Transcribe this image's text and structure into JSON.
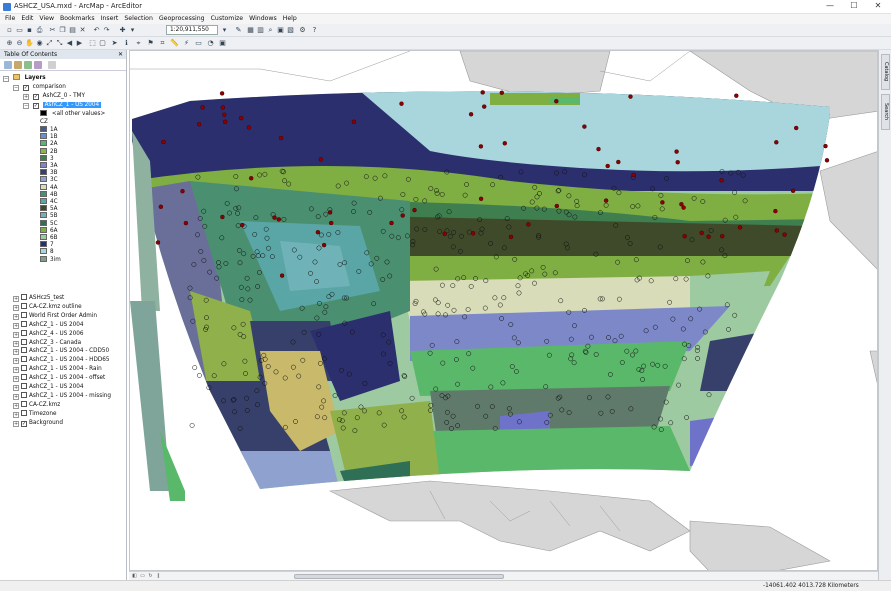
{
  "window": {
    "title": "ASHCZ_USA.mxd - ArcMap - ArcEditor",
    "minimize": "—",
    "maximize": "☐",
    "close": "✕"
  },
  "menu": [
    "File",
    "Edit",
    "View",
    "Bookmarks",
    "Insert",
    "Selection",
    "Geoprocessing",
    "Customize",
    "Windows",
    "Help"
  ],
  "toolbar": {
    "scale": "1:20,911,550"
  },
  "toc": {
    "header": "Table Of Contents",
    "root": "Layers",
    "group": "comparison",
    "layer_tmy": "AshCZ_0 - TMY",
    "layer_selected": "AshCZ_1 - US 2004",
    "legend_other": "<all other values>",
    "legend_field": "CZ",
    "legend": [
      {
        "label": "1A",
        "color": "#4a5a8c"
      },
      {
        "label": "1B",
        "color": "#6f8ec7"
      },
      {
        "label": "2A",
        "color": "#5ab86a"
      },
      {
        "label": "2B",
        "color": "#8fb04a"
      },
      {
        "label": "3",
        "color": "#3f7f4f"
      },
      {
        "label": "3A",
        "color": "#7d88c9"
      },
      {
        "label": "3B",
        "color": "#37406b"
      },
      {
        "label": "3C",
        "color": "#8fa2cf"
      },
      {
        "label": "4A",
        "color": "#d9dcb8"
      },
      {
        "label": "4B",
        "color": "#4a8f70"
      },
      {
        "label": "4C",
        "color": "#5aa6a6"
      },
      {
        "label": "5A",
        "color": "#3e4a2a"
      },
      {
        "label": "5B",
        "color": "#6fb3b8"
      },
      {
        "label": "5C",
        "color": "#2f6f55"
      },
      {
        "label": "6A",
        "color": "#7fae43"
      },
      {
        "label": "6B",
        "color": "#9dcaa0"
      },
      {
        "label": "7",
        "color": "#2b2f6e"
      },
      {
        "label": "8",
        "color": "#a9d6dc"
      },
      {
        "label": "3im",
        "color": "#7f9f8a"
      }
    ],
    "other_layers": [
      {
        "label": "ASHcz5_test",
        "checked": false
      },
      {
        "label": "CA-CZ.kmz outline",
        "checked": false
      },
      {
        "label": "World First Order Admin",
        "checked": false
      },
      {
        "label": "AshCZ_1 - US 2004",
        "checked": false
      },
      {
        "label": "AshCZ_4 - US 2006",
        "checked": false
      },
      {
        "label": "AshCZ_3 - Canada",
        "checked": false
      },
      {
        "label": "AshCZ_1 - US 2004 - CDD50",
        "checked": false
      },
      {
        "label": "AshCZ_1 - US 2004 - HDD65",
        "checked": false
      },
      {
        "label": "AshCZ_1 - US 2004 - Rain",
        "checked": false
      },
      {
        "label": "AshCZ_1 - US 2004 - offset",
        "checked": false
      },
      {
        "label": "AshCZ_1 - US 2004",
        "checked": false
      },
      {
        "label": "AshCZ_1 - US 2004 - missing",
        "checked": false
      },
      {
        "label": "CA-CZ.kmz",
        "checked": false
      },
      {
        "label": "Timezone",
        "checked": false
      },
      {
        "label": "Background",
        "checked": true
      }
    ]
  },
  "status": {
    "coords": "-14061.402  4013.728 Kilometers"
  },
  "right_tabs": [
    "Catalog",
    "Search"
  ],
  "colors": {
    "ocean": "#ffffff",
    "land": "#d6d6d6",
    "selection": "#3399ff"
  }
}
